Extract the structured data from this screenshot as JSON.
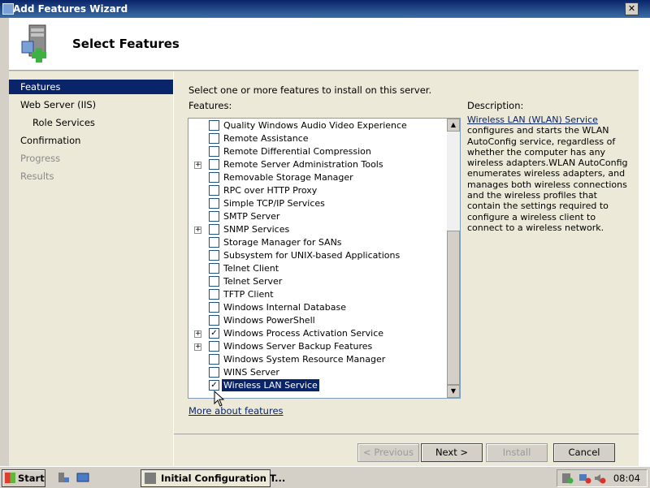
{
  "window": {
    "title": "Add Features Wizard",
    "close_label": "✕"
  },
  "header": {
    "title": "Select Features",
    "icon": "server-add-icon"
  },
  "nav": {
    "items": [
      {
        "label": "Features",
        "state": "active"
      },
      {
        "label": "Web Server (IIS)",
        "state": "normal"
      },
      {
        "label": "Role Services",
        "state": "sub"
      },
      {
        "label": "Confirmation",
        "state": "normal"
      },
      {
        "label": "Progress",
        "state": "disabled"
      },
      {
        "label": "Results",
        "state": "disabled"
      }
    ]
  },
  "main": {
    "instruction": "Select one or more features to install on this server.",
    "features_label": "Features:",
    "description_label": "Description:",
    "features": [
      {
        "label": "Quality Windows Audio Video Experience",
        "expandable": false,
        "checked": false
      },
      {
        "label": "Remote Assistance",
        "expandable": false,
        "checked": false
      },
      {
        "label": "Remote Differential Compression",
        "expandable": false,
        "checked": false
      },
      {
        "label": "Remote Server Administration Tools",
        "expandable": true,
        "checked": false
      },
      {
        "label": "Removable Storage Manager",
        "expandable": false,
        "checked": false
      },
      {
        "label": "RPC over HTTP Proxy",
        "expandable": false,
        "checked": false
      },
      {
        "label": "Simple TCP/IP Services",
        "expandable": false,
        "checked": false
      },
      {
        "label": "SMTP Server",
        "expandable": false,
        "checked": false
      },
      {
        "label": "SNMP Services",
        "expandable": true,
        "checked": false
      },
      {
        "label": "Storage Manager for SANs",
        "expandable": false,
        "checked": false
      },
      {
        "label": "Subsystem for UNIX-based Applications",
        "expandable": false,
        "checked": false
      },
      {
        "label": "Telnet Client",
        "expandable": false,
        "checked": false
      },
      {
        "label": "Telnet Server",
        "expandable": false,
        "checked": false
      },
      {
        "label": "TFTP Client",
        "expandable": false,
        "checked": false
      },
      {
        "label": "Windows Internal Database",
        "expandable": false,
        "checked": false
      },
      {
        "label": "Windows PowerShell",
        "expandable": false,
        "checked": false
      },
      {
        "label": "Windows Process Activation Service",
        "expandable": true,
        "checked": true
      },
      {
        "label": "Windows Server Backup Features",
        "expandable": true,
        "checked": false
      },
      {
        "label": "Windows System Resource Manager",
        "expandable": false,
        "checked": false
      },
      {
        "label": "WINS Server",
        "expandable": false,
        "checked": false
      },
      {
        "label": "Wireless LAN Service",
        "expandable": false,
        "checked": true,
        "selected": true
      }
    ],
    "more_link": "More about features",
    "description": {
      "link": "Wireless LAN (WLAN) Service",
      "text": "configures and starts the WLAN AutoConfig service, regardless of whether the computer has any wireless adapters.WLAN AutoConfig enumerates wireless adapters, and manages both wireless connections and the wireless profiles that contain the settings required to configure a wireless client to connect to a wireless network."
    },
    "buttons": {
      "previous": "< Previous",
      "next": "Next >",
      "install": "Install",
      "cancel": "Cancel"
    }
  },
  "taskbar": {
    "start": "Start",
    "task": "Initial Configuration T...",
    "clock": "08:04"
  }
}
